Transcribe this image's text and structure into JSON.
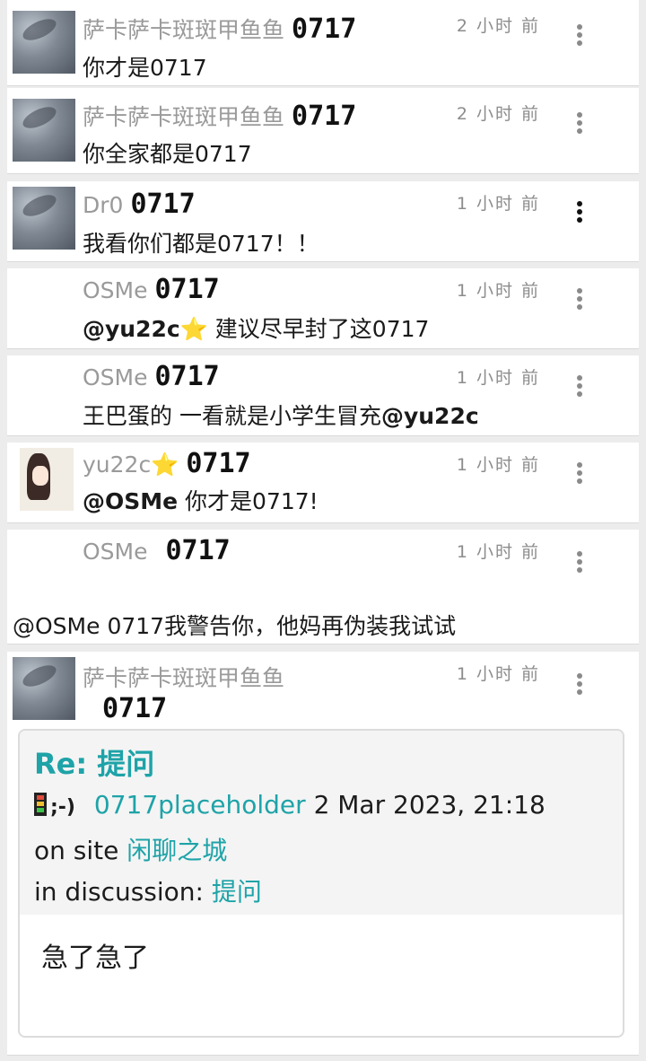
{
  "posts": [
    {
      "name": "萨卡萨卡斑斑甲鱼鱼",
      "badge": "0717",
      "time": "2 小时 前",
      "message": "你才是0717"
    },
    {
      "name": "萨卡萨卡斑斑甲鱼鱼",
      "badge": "0717",
      "time": "2 小时 前",
      "message": "你全家都是0717"
    },
    {
      "name": "Dr0",
      "badge": "0717",
      "time": "1 小时 前",
      "message": "我看你们都是0717！！"
    },
    {
      "name": "OSMe",
      "badge": "0717",
      "time": "1 小时 前",
      "mention": "@yu22c",
      "mention_star": "⭐",
      "message": " 建议尽早封了这0717"
    },
    {
      "name": "OSMe",
      "badge": "0717",
      "time": "1 小时 前",
      "message": "王巴蛋的 一看就是小学生冒充",
      "mention_end": "@yu22c"
    },
    {
      "name": "yu22c",
      "name_star": "⭐",
      "badge": "0717",
      "time": "1 小时 前",
      "mention": "@OSMe",
      "message": " 你才是0717!"
    },
    {
      "name": "OSMe",
      "badge": "0717",
      "time": "1 小时 前",
      "message": "@OSMe 0717我警告你，他妈再伪装我试试"
    },
    {
      "name": "萨卡萨卡斑斑甲鱼鱼",
      "badge": "0717",
      "time": "1 小时 前",
      "quote": {
        "title": "Re: 提问",
        "emoticon": ";-)",
        "author": "0717placeholder",
        "date": "2 Mar 2023, 21:18",
        "site_prefix": "on site ",
        "site": "闲聊之城",
        "discussion_prefix": "in discussion: ",
        "discussion": "提问",
        "body": "急了急了"
      }
    }
  ],
  "colors": {
    "accent": "#1ea3a8",
    "background": "#ececec",
    "muted": "#9a9a9a"
  }
}
